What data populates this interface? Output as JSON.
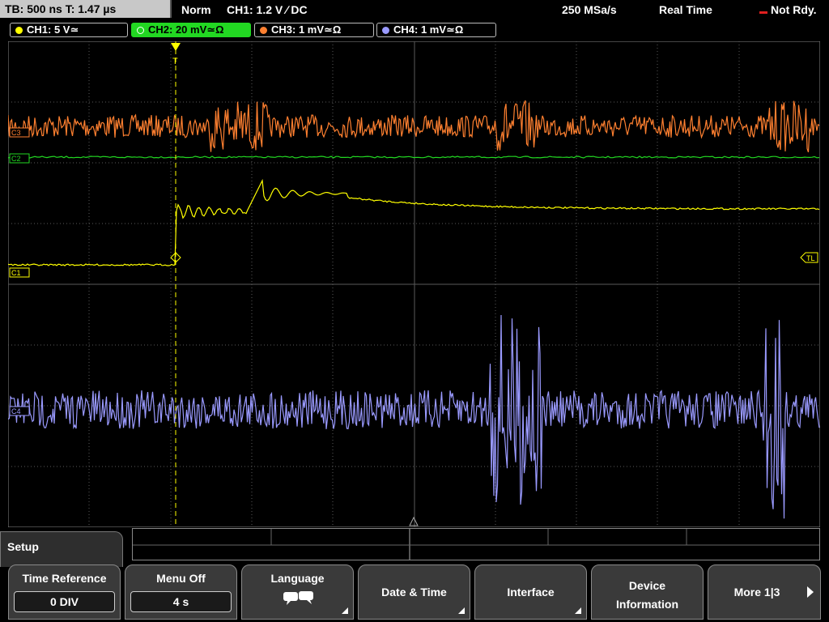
{
  "topbar": {
    "timebase": "TB: 500 ns  T: 1.47 µs",
    "mode": "Norm",
    "trigger": "CH1: 1.2 V ∕ DC",
    "sample_rate": "250 MSa/s",
    "acq_mode": "Real Time",
    "status": "Not Rdy."
  },
  "channels": [
    {
      "label": "CH1: 5 V≃",
      "color": "#ffff00"
    },
    {
      "label": "CH2: 20 mV≃Ω",
      "color": "#22d822"
    },
    {
      "label": "CH3: 1 mV≃Ω",
      "color": "#ff8030"
    },
    {
      "label": "CH4: 1 mV≃Ω",
      "color": "#9a9aff"
    }
  ],
  "markers": {
    "ch3": "C3",
    "ch2": "C2",
    "ch1": "C1",
    "ch4": "C4",
    "trigger_level": "TL",
    "trigger_pos": "T"
  },
  "menu": {
    "title": "Setup",
    "softkeys": [
      {
        "title": "Time Reference",
        "value": "0 DIV"
      },
      {
        "title": "Menu Off",
        "value": "4 s"
      },
      {
        "title": "Language",
        "value": ""
      },
      {
        "title": "Date & Time",
        "value": ""
      },
      {
        "title": "Interface",
        "value": ""
      },
      {
        "title": "Device\nInformation",
        "value": ""
      },
      {
        "title": "More 1|3",
        "value": ""
      }
    ]
  },
  "colors": {
    "grid": "#5a5a5a",
    "ch1": "#ffff00",
    "ch2": "#22d822",
    "ch3": "#ff8030",
    "ch4": "#9a9aff"
  }
}
